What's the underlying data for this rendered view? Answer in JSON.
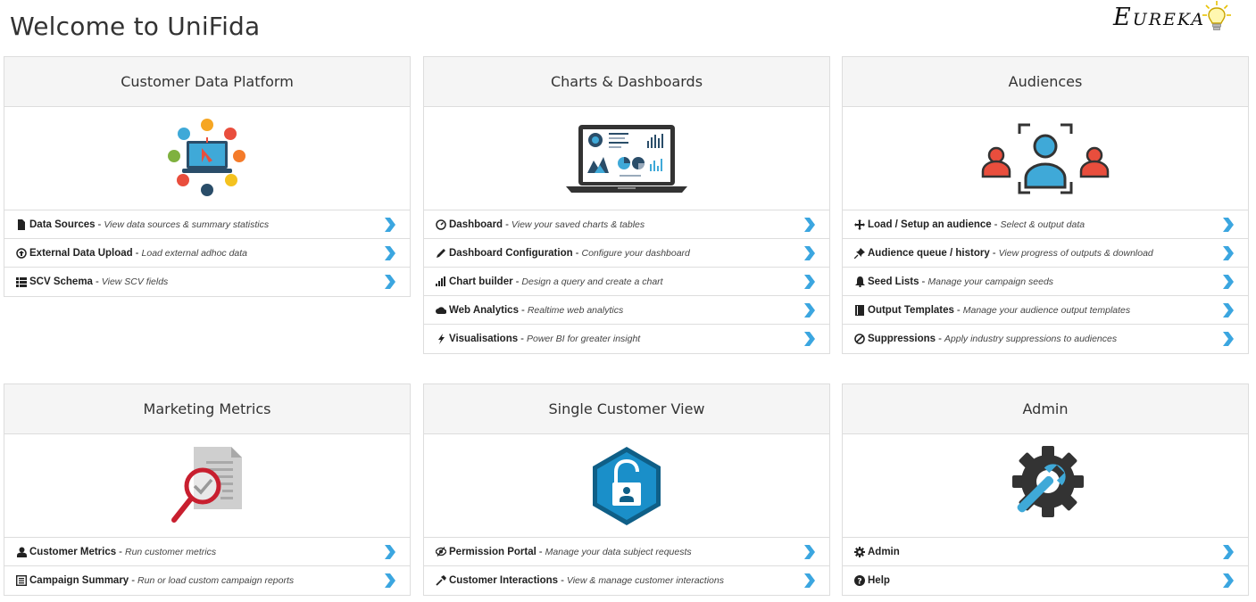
{
  "page": {
    "title": "Welcome to UniFida",
    "logo_text": "Eureka",
    "accent": "#3ba6e0"
  },
  "panels": [
    {
      "title": "Customer Data Platform",
      "image": "customer-data-platform-illustration",
      "items": [
        {
          "icon": "file-icon",
          "title": "Data Sources",
          "desc": "View data sources & summary statistics"
        },
        {
          "icon": "upload-icon",
          "title": "External Data Upload",
          "desc": "Load external adhoc data"
        },
        {
          "icon": "list-icon",
          "title": "SCV Schema",
          "desc": "View SCV fields"
        }
      ]
    },
    {
      "title": "Charts & Dashboards",
      "image": "laptop-dashboard-illustration",
      "items": [
        {
          "icon": "dashboard-icon",
          "title": "Dashboard",
          "desc": "View your saved charts & tables"
        },
        {
          "icon": "pencil-icon",
          "title": "Dashboard Configuration",
          "desc": "Configure your dashboard"
        },
        {
          "icon": "signal-icon",
          "title": "Chart builder",
          "desc": "Design a query and create a chart"
        },
        {
          "icon": "cloud-icon",
          "title": "Web Analytics",
          "desc": "Realtime web analytics"
        },
        {
          "icon": "flash-icon",
          "title": "Visualisations",
          "desc": "Power BI for greater insight"
        }
      ]
    },
    {
      "title": "Audiences",
      "image": "audience-illustration",
      "items": [
        {
          "icon": "move-icon",
          "title": "Load / Setup an audience",
          "desc": "Select & output data"
        },
        {
          "icon": "pushpin-icon",
          "title": "Audience queue / history",
          "desc": "View progress of outputs & download"
        },
        {
          "icon": "bell-icon",
          "title": "Seed Lists",
          "desc": "Manage your campaign seeds"
        },
        {
          "icon": "book-icon",
          "title": "Output Templates",
          "desc": "Manage your audience output templates"
        },
        {
          "icon": "ban-icon",
          "title": "Suppressions",
          "desc": "Apply industry suppressions to audiences"
        }
      ]
    },
    {
      "title": "Marketing Metrics",
      "image": "document-magnifier-illustration",
      "items": [
        {
          "icon": "user-icon",
          "title": "Customer Metrics",
          "desc": "Run customer metrics"
        },
        {
          "icon": "list-alt-icon",
          "title": "Campaign Summary",
          "desc": "Run or load custom campaign reports"
        }
      ]
    },
    {
      "title": "Single Customer View",
      "image": "unlock-shield-illustration",
      "items": [
        {
          "icon": "eye-slash-icon",
          "title": "Permission Portal",
          "desc": "Manage your data subject requests"
        },
        {
          "icon": "tools-icon",
          "title": "Customer Interactions",
          "desc": "View & manage customer interactions"
        }
      ]
    },
    {
      "title": "Admin",
      "image": "gear-wrench-illustration",
      "items": [
        {
          "icon": "cog-icon",
          "title": "Admin",
          "desc": ""
        },
        {
          "icon": "question-sign-icon",
          "title": "Help",
          "desc": ""
        }
      ]
    }
  ]
}
